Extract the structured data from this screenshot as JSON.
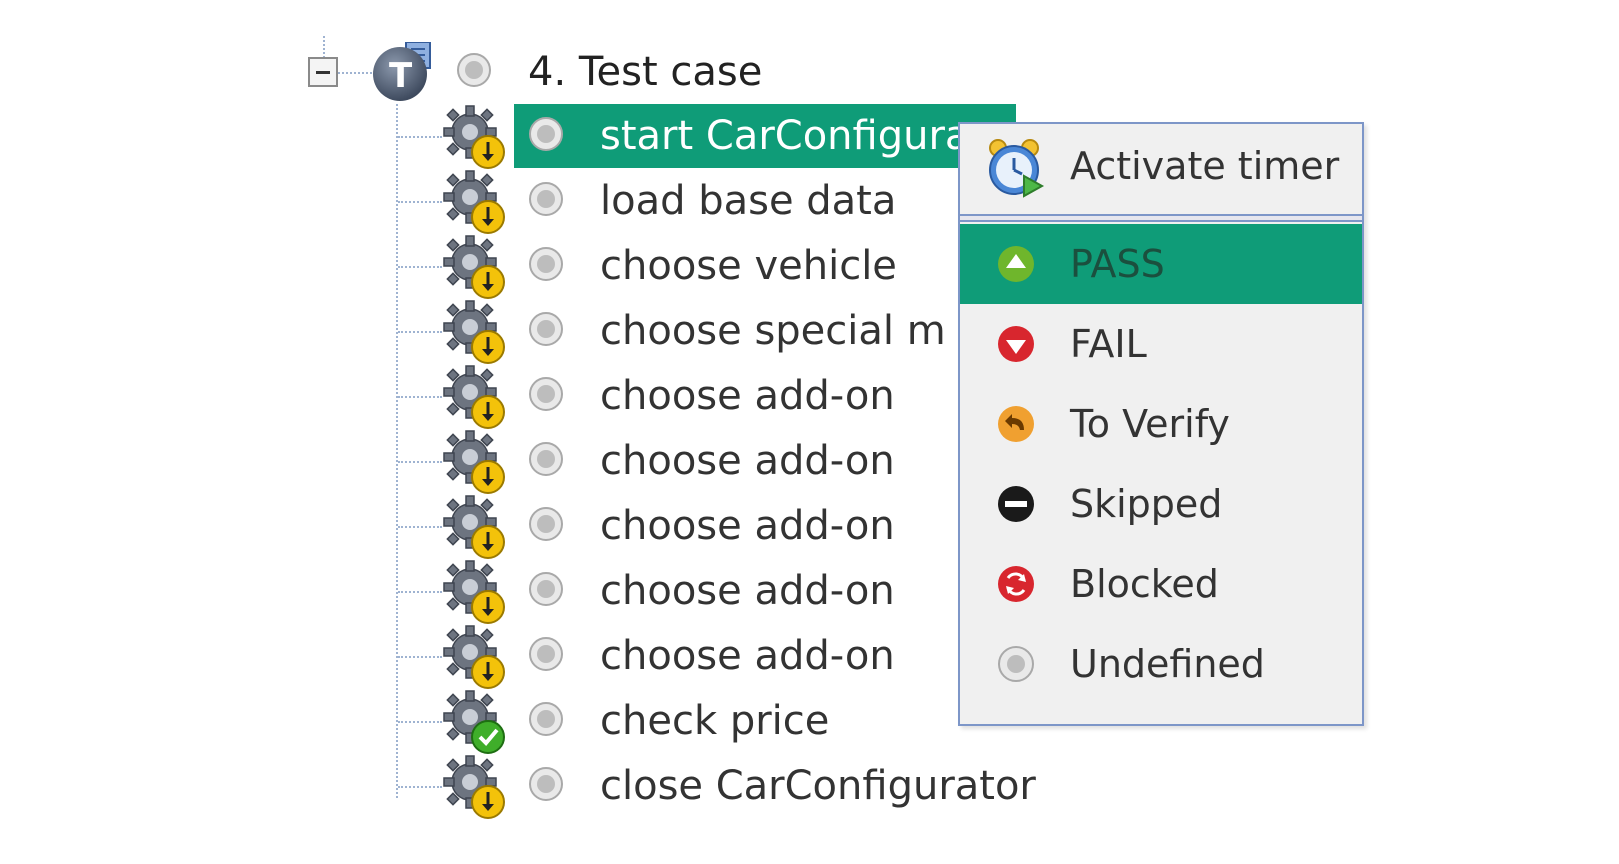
{
  "tree": {
    "root": {
      "label": "4. Test case",
      "status": "undefined"
    },
    "steps": [
      {
        "label": "start CarConfigura",
        "kind": "gear-pending",
        "status": "undefined",
        "selected": true
      },
      {
        "label": "load base data",
        "kind": "gear-pending",
        "status": "undefined"
      },
      {
        "label": "choose vehicle",
        "kind": "gear-pending",
        "status": "undefined"
      },
      {
        "label": "choose special m",
        "kind": "gear-pending",
        "status": "undefined"
      },
      {
        "label": "choose add-on",
        "kind": "gear-pending",
        "status": "undefined"
      },
      {
        "label": "choose add-on",
        "kind": "gear-pending",
        "status": "undefined"
      },
      {
        "label": "choose add-on",
        "kind": "gear-pending",
        "status": "undefined"
      },
      {
        "label": "choose add-on",
        "kind": "gear-pending",
        "status": "undefined"
      },
      {
        "label": "choose add-on",
        "kind": "gear-pending",
        "status": "undefined"
      },
      {
        "label": "check price",
        "kind": "gear-check",
        "status": "undefined"
      },
      {
        "label": "close CarConfigurator",
        "kind": "gear-pending",
        "status": "undefined"
      }
    ]
  },
  "context_menu": {
    "timer": {
      "label": "Activate timer",
      "icon": "alarm-clock-icon"
    },
    "items": [
      {
        "label": "PASS",
        "icon": "pass-icon",
        "color": "#6fb62c",
        "highlighted": true
      },
      {
        "label": "FAIL",
        "icon": "fail-icon",
        "color": "#d8262e"
      },
      {
        "label": "To Verify",
        "icon": "to-verify-icon",
        "color": "#f0a030"
      },
      {
        "label": "Skipped",
        "icon": "skipped-icon",
        "color": "#1a1a1a"
      },
      {
        "label": "Blocked",
        "icon": "blocked-icon",
        "color": "#d8262e"
      },
      {
        "label": "Undefined",
        "icon": "undefined-icon",
        "color": "#bdbdbd"
      }
    ]
  },
  "colors": {
    "selection": "#0f9c78",
    "menu_border": "#7d96c8",
    "menu_bg": "#f0f0f0"
  }
}
